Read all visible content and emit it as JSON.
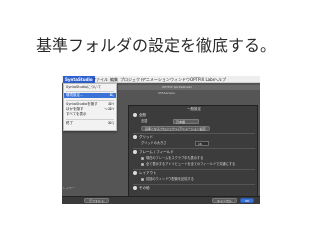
{
  "slide": {
    "title": "基準フォルダの設定を徹底する。"
  },
  "menubar": {
    "app": "SyntaStudio",
    "items": [
      "ファイル",
      "編集",
      "プロジェクト",
      "アニメーション",
      "ウィンドウ",
      "OPTPiX Labs",
      "ヘルプ"
    ]
  },
  "menu": {
    "items": [
      {
        "label": "SyntaStudioについて",
        "shortcut": ""
      },
      {
        "label": "環境設定...",
        "shortcut": "⌘,"
      },
      {
        "label": "SyntaStudioを隠す",
        "shortcut": "⌘H"
      },
      {
        "label": "ほかを隠す",
        "shortcut": "⌥⌘H"
      },
      {
        "label": "すべてを表示",
        "shortcut": ""
      },
      {
        "label": "終了",
        "shortcut": "⌘Q"
      }
    ]
  },
  "app": {
    "toolbar_title": "OPTPiX SpriteStudio",
    "doc_title": "SS5Sample",
    "side_label": "レイヤー"
  },
  "dialog": {
    "title": "一般設定",
    "sections": {
      "general": "全般",
      "language_label": "言語",
      "language_value": "日本語",
      "base_button": "基準となるプロジェクト/アニメーション設定",
      "grid": "グリッド",
      "grid_size_label": "グリッドの大きさ",
      "grid_size_value": "16",
      "frame": "フレーム / フィールド",
      "frame_opt1": "現在のフレームをスクラブ中も表示する",
      "frame_opt2": "全て表示するアトリビュートを全てのフィールドで共通にする",
      "layout": "レイアウト",
      "layout_opt1": "前回のウィンドウ配置を記憶する",
      "other": "その他"
    },
    "buttons": {
      "reset": "デフォルト",
      "cancel": "キャンセル",
      "ok": "OK"
    }
  }
}
